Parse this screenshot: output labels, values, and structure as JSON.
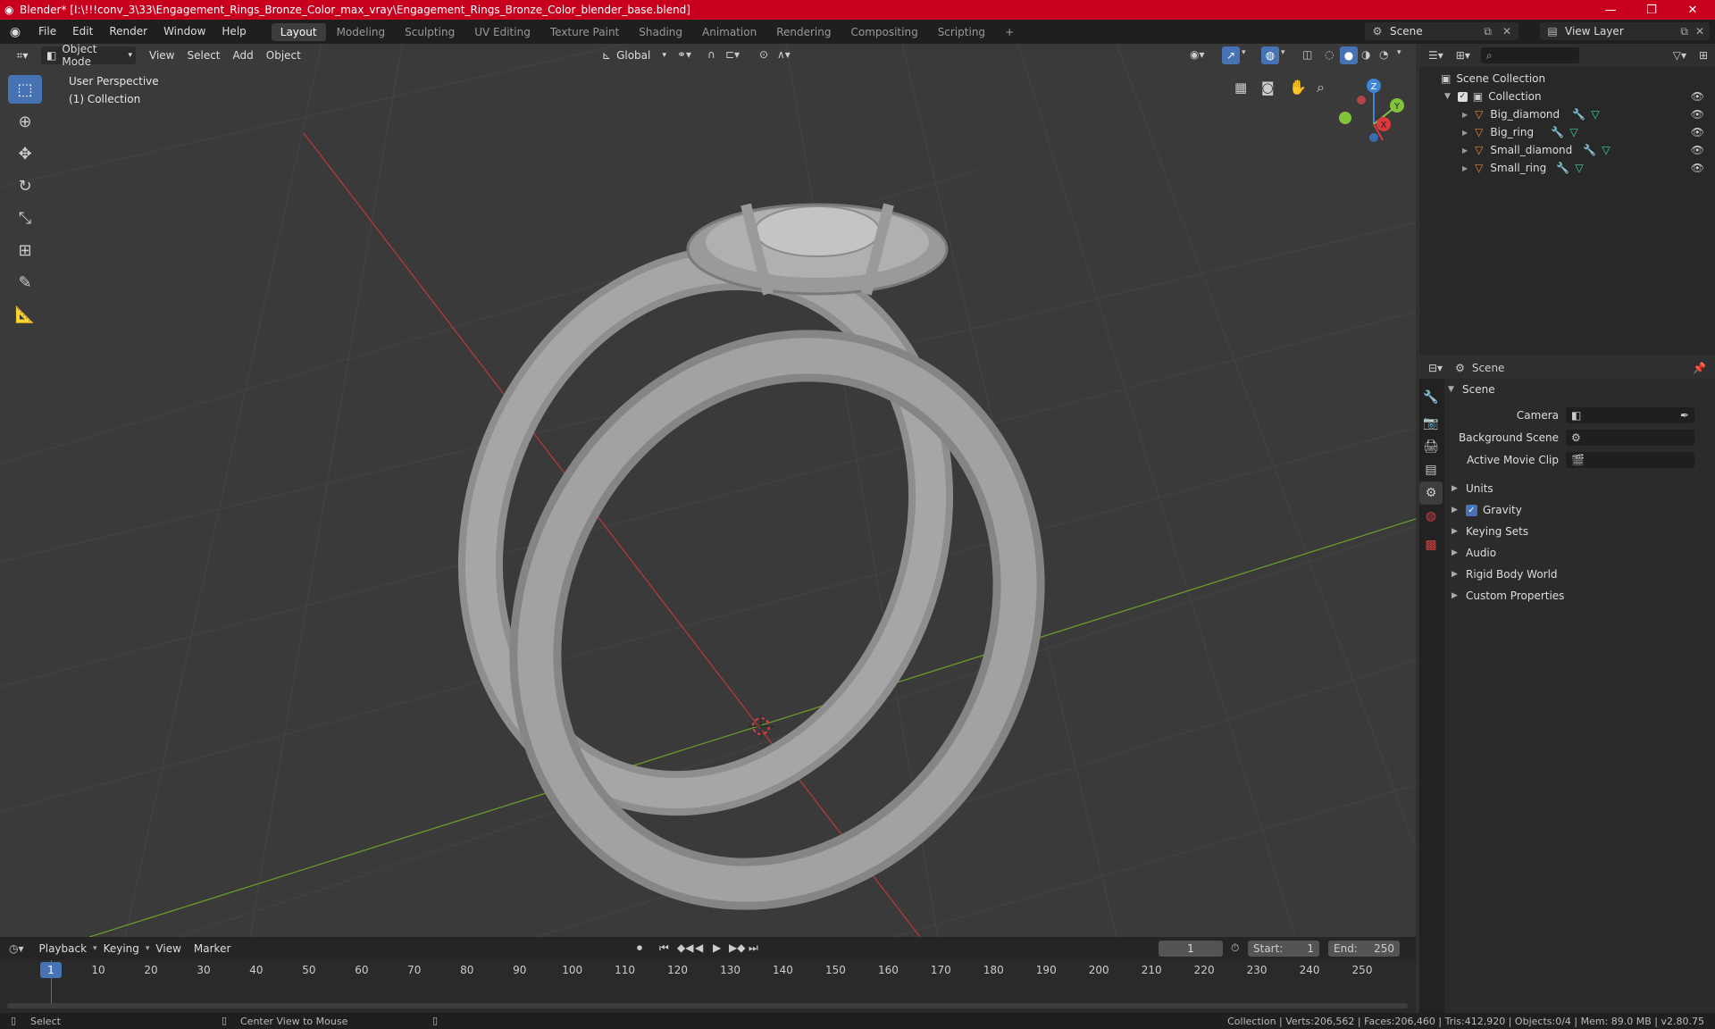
{
  "window": {
    "title": "Blender* [I:\\!!!conv_3\\33\\Engagement_Rings_Bronze_Color_max_vray\\Engagement_Rings_Bronze_Color_blender_base.blend]",
    "minimize": "—",
    "maximize": "❐",
    "close": "✕"
  },
  "menus": [
    "File",
    "Edit",
    "Render",
    "Window",
    "Help"
  ],
  "workspaces": [
    "Layout",
    "Modeling",
    "Sculpting",
    "UV Editing",
    "Texture Paint",
    "Shading",
    "Animation",
    "Rendering",
    "Compositing",
    "Scripting"
  ],
  "workspace_add": "+",
  "scene_selector": {
    "value": "Scene"
  },
  "view_layer_selector": {
    "value": "View Layer"
  },
  "viewport": {
    "mode": "Object Mode",
    "menus": [
      "View",
      "Select",
      "Add",
      "Object"
    ],
    "orientation": "Global",
    "overlay_line1": "User Perspective",
    "overlay_line2": "(1) Collection",
    "axes": {
      "x": "X",
      "y": "Y",
      "z": "Z"
    }
  },
  "outliner": {
    "search_placeholder": "",
    "root": "Scene Collection",
    "collection": "Collection",
    "objects": [
      "Big_diamond",
      "Big_ring",
      "Small_diamond",
      "Small_ring"
    ]
  },
  "properties": {
    "breadcrumb": "Scene",
    "panel_title": "Scene",
    "camera_label": "Camera",
    "background_scene_label": "Background Scene",
    "active_movie_clip_label": "Active Movie Clip",
    "subpanels": [
      "Units",
      "Gravity",
      "Keying Sets",
      "Audio",
      "Rigid Body World",
      "Custom Properties"
    ],
    "gravity_checked": true
  },
  "timeline": {
    "menus": [
      "Playback",
      "Keying",
      "View",
      "Marker"
    ],
    "current_frame": "1",
    "start_label": "Start:",
    "start": "1",
    "end_label": "End:",
    "end": "250",
    "ticks": [
      "1",
      "10",
      "20",
      "30",
      "40",
      "50",
      "60",
      "70",
      "80",
      "90",
      "100",
      "110",
      "120",
      "130",
      "140",
      "150",
      "160",
      "170",
      "180",
      "190",
      "200",
      "210",
      "220",
      "230",
      "240",
      "250"
    ]
  },
  "statusbar": {
    "left_action": "Select",
    "middle_action": "Center View to Mouse",
    "stats": "Collection | Verts:206,562 | Faces:206,460 | Tris:412,920 | Objects:0/4 | Mem: 89.0 MB | v2.80.75"
  },
  "colors": {
    "title_red": "#c8001e",
    "accent_blue": "#4772b3",
    "x_axis": "#e0383c",
    "y_axis": "#82c43a",
    "z_axis": "#3f86d9",
    "mesh_orange": "#e08a3a"
  }
}
